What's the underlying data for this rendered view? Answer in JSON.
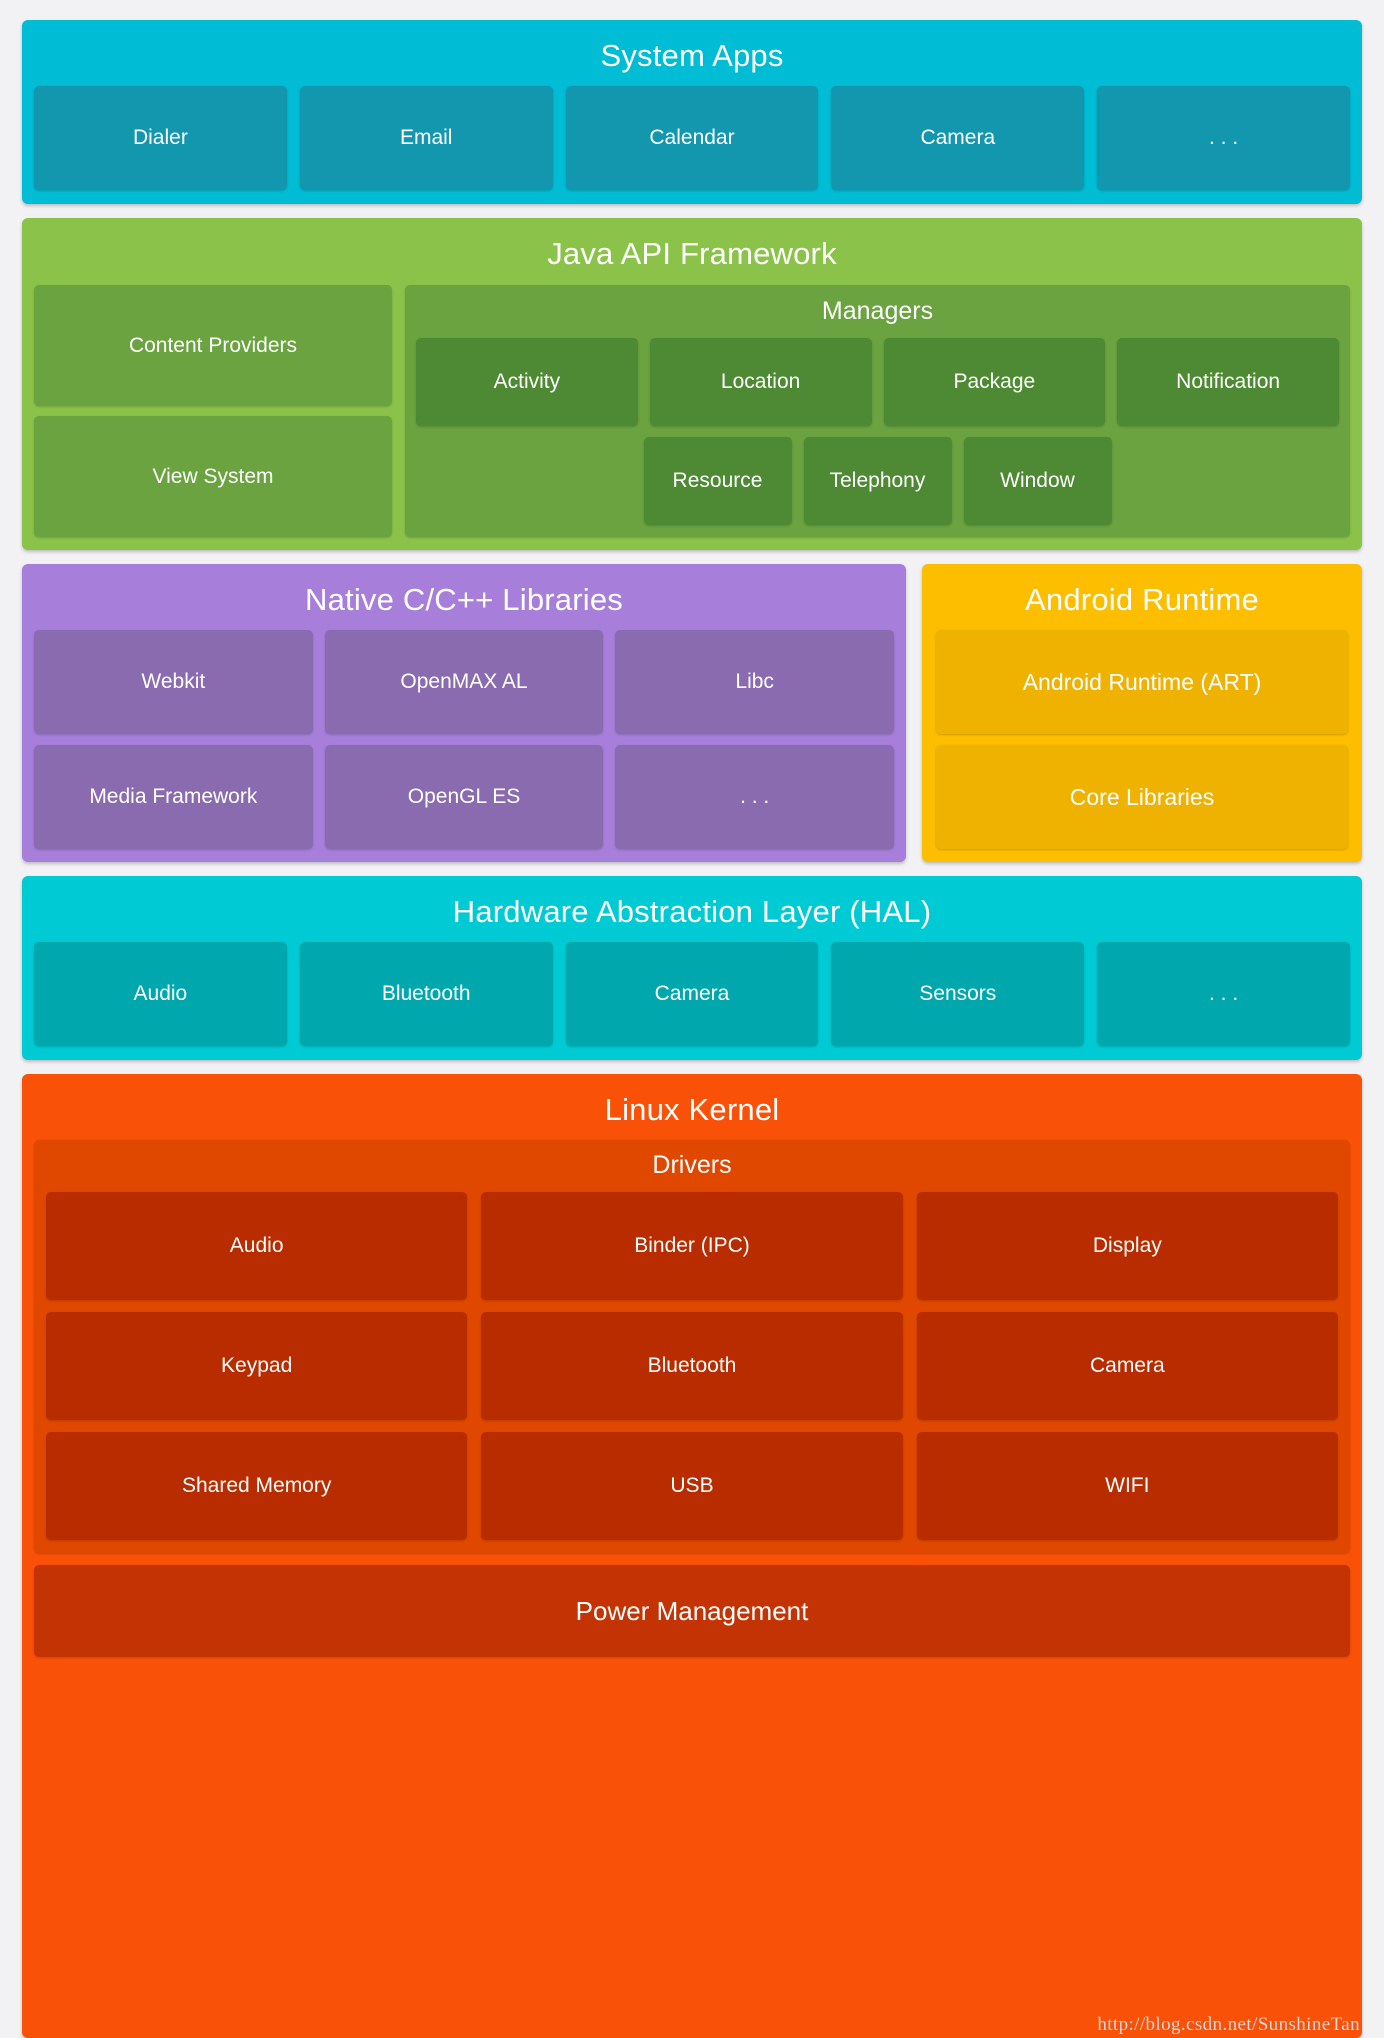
{
  "watermark": "http://blog.csdn.net/SunshineTan",
  "colors": {
    "page_background": "#F2F2F4",
    "system_apps": "#00BCD4",
    "system_apps_tile": "#1397AF",
    "java_api": "#8BC34A",
    "java_api_tile": "#6AA340",
    "java_api_manager_tile": "#4E8A33",
    "native_libs": "#A77FDB",
    "native_libs_tile": "#8A6BB0",
    "android_runtime": "#FDBE00",
    "android_runtime_tile": "#EFB200",
    "hal": "#00CBD4",
    "hal_tile": "#00A8AE",
    "linux_kernel": "#F95208",
    "drivers": "#E04800",
    "drivers_tile": "#B82C00",
    "power_management": "#C43304"
  },
  "layers": {
    "system_apps": {
      "title": "System Apps",
      "apps": [
        {
          "label": "Dialer"
        },
        {
          "label": "Email"
        },
        {
          "label": "Calendar"
        },
        {
          "label": "Camera"
        },
        {
          "label": ". . ."
        }
      ]
    },
    "java_api_framework": {
      "title": "Java API Framework",
      "left_items": [
        {
          "label": "Content Providers"
        },
        {
          "label": "View System"
        }
      ],
      "managers": {
        "title": "Managers",
        "row1": [
          {
            "label": "Activity"
          },
          {
            "label": "Location"
          },
          {
            "label": "Package"
          },
          {
            "label": "Notification"
          }
        ],
        "row2": [
          {
            "label": "Resource"
          },
          {
            "label": "Telephony"
          },
          {
            "label": "Window"
          }
        ]
      }
    },
    "native_libraries": {
      "title": "Native C/C++ Libraries",
      "row1": [
        {
          "label": "Webkit"
        },
        {
          "label": "OpenMAX AL"
        },
        {
          "label": "Libc"
        }
      ],
      "row2": [
        {
          "label": "Media Framework"
        },
        {
          "label": "OpenGL ES"
        },
        {
          "label": ". . ."
        }
      ]
    },
    "android_runtime": {
      "title": "Android Runtime",
      "items": [
        {
          "label": "Android Runtime (ART)"
        },
        {
          "label": "Core Libraries"
        }
      ]
    },
    "hal": {
      "title": "Hardware Abstraction Layer (HAL)",
      "items": [
        {
          "label": "Audio"
        },
        {
          "label": "Bluetooth"
        },
        {
          "label": "Camera"
        },
        {
          "label": "Sensors"
        },
        {
          "label": ". . ."
        }
      ]
    },
    "linux_kernel": {
      "title": "Linux Kernel",
      "drivers": {
        "title": "Drivers",
        "row1": [
          {
            "label": "Audio"
          },
          {
            "label": "Binder (IPC)"
          },
          {
            "label": "Display"
          }
        ],
        "row2": [
          {
            "label": "Keypad"
          },
          {
            "label": "Bluetooth"
          },
          {
            "label": "Camera"
          }
        ],
        "row3": [
          {
            "label": "Shared Memory"
          },
          {
            "label": "USB"
          },
          {
            "label": "WIFI"
          }
        ]
      },
      "power_management": {
        "label": "Power Management"
      }
    }
  }
}
